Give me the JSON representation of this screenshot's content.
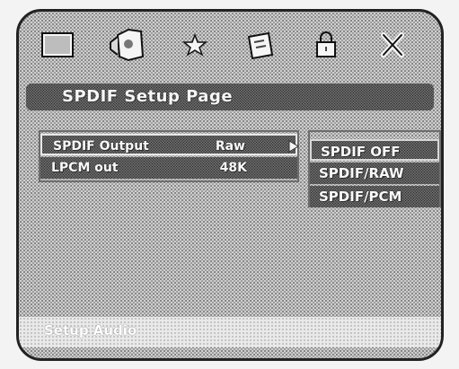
{
  "window": {
    "title": "SPDIF Setup Page"
  },
  "toolbar": {
    "items": [
      {
        "label": "",
        "icon": "monitor-icon"
      },
      {
        "label": "",
        "icon": "speaker-icon"
      },
      {
        "label": "",
        "icon": "star-icon"
      },
      {
        "label": "",
        "icon": "card-icon"
      },
      {
        "label": "",
        "icon": "lock-icon"
      },
      {
        "label": "",
        "icon": "close-icon"
      }
    ]
  },
  "page": {
    "title": "SPDIF Setup Page"
  },
  "menu": {
    "rows": [
      {
        "label": "SPDIF Output",
        "value": "Raw"
      },
      {
        "label": "LPCM out",
        "value": "48K"
      }
    ]
  },
  "options": {
    "items": [
      "SPDIF OFF",
      "SPDIF/RAW",
      "SPDIF/PCM"
    ]
  },
  "footer": {
    "text": "Setup Audio"
  },
  "colors": {
    "frame": "#222222",
    "text": "#f9f9f9",
    "panel": "#cfcfcf",
    "dark_panel": "#a9a9a9"
  }
}
